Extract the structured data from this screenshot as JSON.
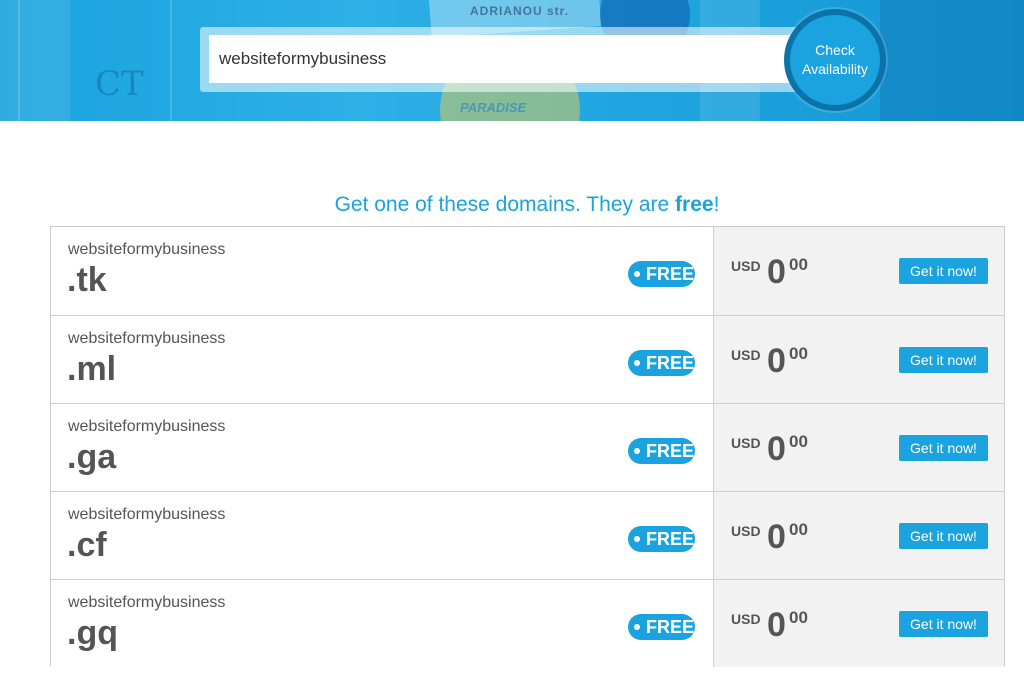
{
  "search": {
    "value": "websiteformybusiness",
    "button_line1": "Check",
    "button_line2": "Availability"
  },
  "hero_decor": {
    "street_sign": "ADRIANOU str.",
    "shop_sign": "PARADISE",
    "wall_letters": "CT"
  },
  "heading": {
    "prefix": "Get one of these domains. They are ",
    "emphasis": "free",
    "suffix": "!"
  },
  "domains": [
    {
      "sld": "websiteformybusiness",
      "tld": ".tk",
      "badge": "FREE",
      "currency": "USD",
      "price_int": "0",
      "price_dec": "00",
      "button": "Get it now!"
    },
    {
      "sld": "websiteformybusiness",
      "tld": ".ml",
      "badge": "FREE",
      "currency": "USD",
      "price_int": "0",
      "price_dec": "00",
      "button": "Get it now!"
    },
    {
      "sld": "websiteformybusiness",
      "tld": ".ga",
      "badge": "FREE",
      "currency": "USD",
      "price_int": "0",
      "price_dec": "00",
      "button": "Get it now!"
    },
    {
      "sld": "websiteformybusiness",
      "tld": ".cf",
      "badge": "FREE",
      "currency": "USD",
      "price_int": "0",
      "price_dec": "00",
      "button": "Get it now!"
    },
    {
      "sld": "websiteformybusiness",
      "tld": ".gq",
      "badge": "FREE",
      "currency": "USD",
      "price_int": "0",
      "price_dec": "00",
      "button": "Get it now!"
    }
  ],
  "colors": {
    "accent": "#1aa3de",
    "button_ring": "#0b73a8",
    "price_panel": "#f2f2f2",
    "text": "#555555"
  }
}
